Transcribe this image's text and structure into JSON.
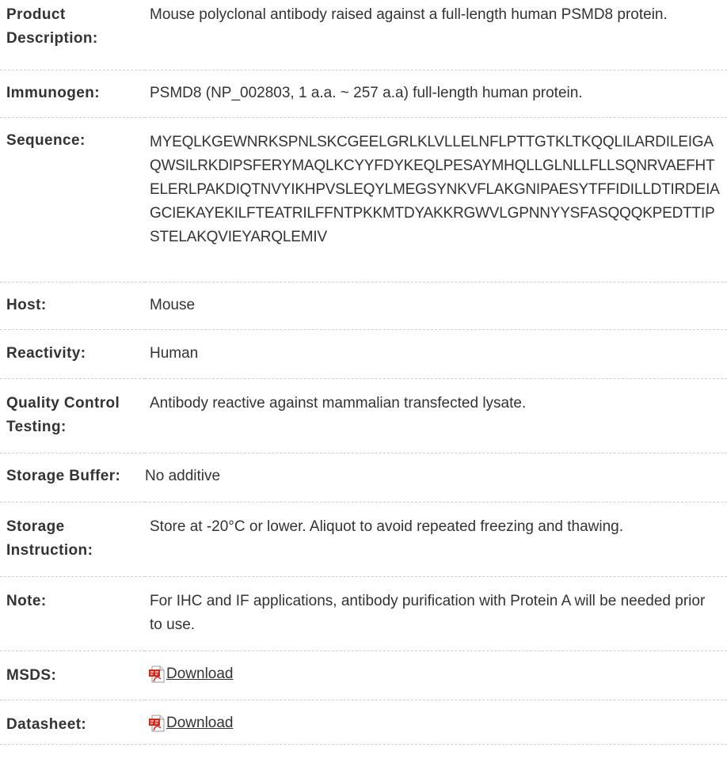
{
  "rows": [
    {
      "label": "Product Description:",
      "value": "Mouse polyclonal antibody raised against a full-length human PSMD8 protein."
    },
    {
      "label": "Immunogen:",
      "value": "PSMD8 (NP_002803, 1 a.a. ~ 257 a.a) full-length human protein."
    },
    {
      "label": "Sequence:",
      "value": "MYEQLKGEWNRKSPNLSKCGEELGRLKLVLLELNFLPTTGTKLTKQQLILARDILEIGAQWSILRKDIPSFERYMAQLKCYYFDYKEQLPESAYMHQLLGLNLLFLLSQNRVAEFHTELERLPAKDIQTNVYIKHPVSLEQYLMEGSYNKVFLAKGNIPAESYTFFIDILLDTIRDEIAGCIEKAYEKILFTEATRILFFNTPKKMTDYAKKRGWVLGPNNYYSFASQQQKPEDTTIPSTELAKQVIEYARQLEMIV"
    },
    {
      "label": "Host:",
      "value": "Mouse"
    },
    {
      "label": "Reactivity:",
      "value": "Human"
    },
    {
      "label": "Quality Control Testing:",
      "value": "Antibody reactive against mammalian transfected lysate."
    },
    {
      "label": "Storage Buffer:",
      "value": "No additive"
    },
    {
      "label": "Storage Instruction:",
      "value": "Store at -20°C or lower. Aliquot to avoid repeated freezing and thawing."
    },
    {
      "label": "Note:",
      "value": "For IHC and IF applications, antibody purification with Protein A will be needed prior to use."
    },
    {
      "label": "MSDS:",
      "link": "Download",
      "icon": "pdf-icon"
    },
    {
      "label": "Datasheet:",
      "link": "Download",
      "icon": "pdf-icon"
    }
  ],
  "colors": {
    "text": "#333333",
    "divider": "#cfcfcf",
    "pdf_red": "#d42b1e"
  }
}
